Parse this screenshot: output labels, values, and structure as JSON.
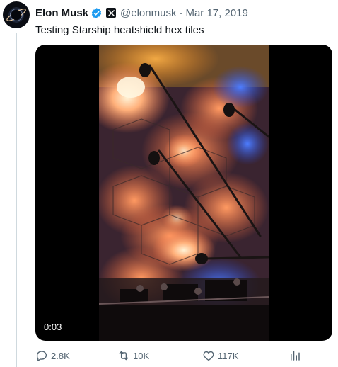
{
  "tweet": {
    "author_name": "Elon Musk",
    "handle": "@elonmusk",
    "separator": "·",
    "date": "Mar 17, 2019",
    "text": "Testing Starship heatshield hex tiles"
  },
  "media": {
    "timestamp": "0:03"
  },
  "actions": {
    "replies": "2.8K",
    "reposts": "10K",
    "likes": "117K"
  },
  "icons": {
    "verified": "verified-badge-icon",
    "affiliate": "x-logo-icon",
    "reply": "reply-icon",
    "repost": "repost-icon",
    "like": "heart-icon",
    "views": "analytics-icon"
  },
  "colors": {
    "verified_blue": "#1d9bf0",
    "muted_text": "#536471",
    "thread_line": "#cfd9de"
  }
}
